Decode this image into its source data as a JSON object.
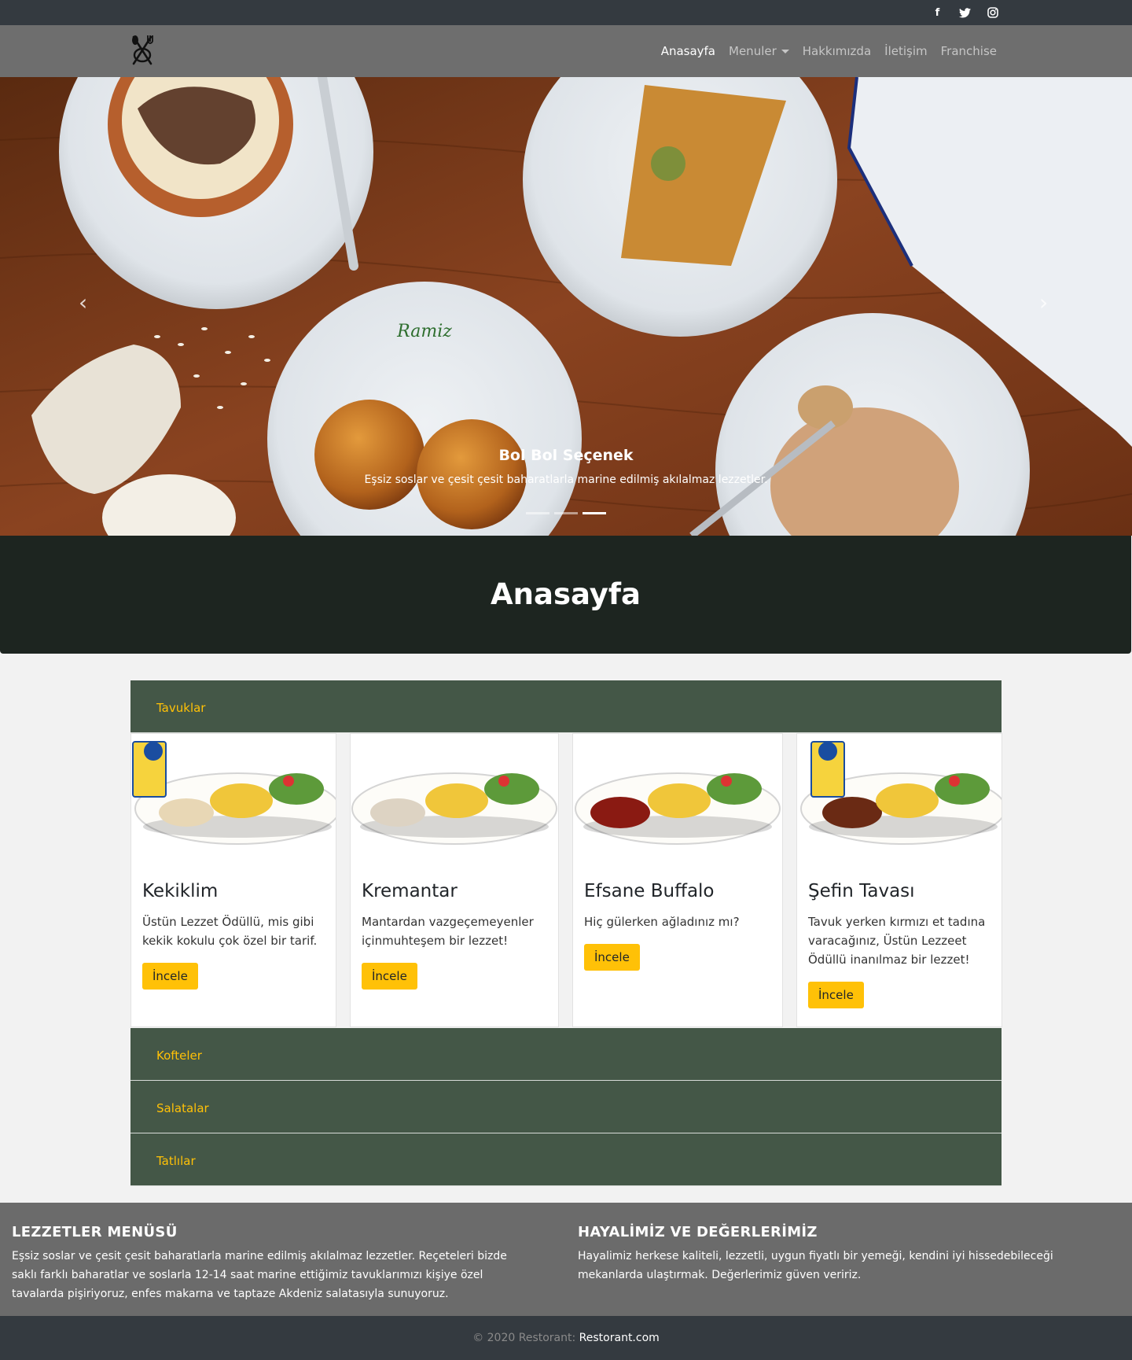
{
  "social": {
    "facebook": "f",
    "twitter": "t",
    "instagram": "◎"
  },
  "nav": {
    "items": [
      {
        "label": "Anasayfa"
      },
      {
        "label": "Menuler"
      },
      {
        "label": "Hakkımızda"
      },
      {
        "label": "İletişim"
      },
      {
        "label": "Franchise"
      }
    ]
  },
  "carousel": {
    "caption_title": "Bol Bol Seçenek",
    "caption_text": "Eşsiz soslar ve çesit çesit baharatlarla marine edilmiş akılalmaz lezzetler.",
    "prev_icon": "‹",
    "next_icon": "›",
    "plate_brand": "Ramiz"
  },
  "page_title": "Anasayfa",
  "categories": [
    "Tavuklar",
    "Kofteler",
    "Salatalar",
    "Tatlılar"
  ],
  "products": [
    {
      "name": "Kekiklim",
      "desc": "Üstün Lezzet Ödüllü, mis gibi kekik kokulu çok özel bir tarif.",
      "button": "İncele",
      "award": true
    },
    {
      "name": "Kremantar",
      "desc": "Mantardan vazgeçemeyenler içinmuhteşem bir lezzet!",
      "button": "İncele",
      "award": false
    },
    {
      "name": "Efsane Buffalo",
      "desc": "Hiç gülerken ağladınız mı?",
      "button": "İncele",
      "award": false
    },
    {
      "name": "Şefin Tavası",
      "desc": "Tavuk yerken kırmızı et tadına varacağınız, Üstün Lezzeet Ödüllü inanılmaz bir lezzet!",
      "button": "İncele",
      "award": true
    }
  ],
  "footer": {
    "col1_title": "LEZZETLER MENÜSÜ",
    "col1_text": "Eşsiz soslar ve çesit çesit baharatlarla marine edilmiş akılalmaz lezzetler. Reçeteleri bizde saklı farklı baharatlar ve soslarla 12-14 saat marine ettiğimiz tavuklarımızı kişiye özel tavalarda pişiriyoruz, enfes makarna ve taptaze Akdeniz salatasıyla sunuyoruz.",
    "col2_title": "HAYALİMİZ VE DEĞERLERİMİZ",
    "col2_text": "Hayalimiz herkese kaliteli, lezzetli, uygun fiyatlı bir yemeği, kendini iyi hissedebileceği mekanlarda ulaştırmak. Değerlerimiz güven veririz."
  },
  "copyright": {
    "text": "© 2020 Restorant: ",
    "link": "Restorant.com"
  },
  "colors": {
    "accent": "#ffc107",
    "category_bg": "#445747",
    "header_dark": "#1d2520",
    "navbar": "#6e6e6e"
  }
}
